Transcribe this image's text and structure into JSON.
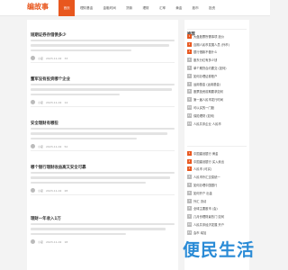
{
  "site": {
    "logo": "编故事"
  },
  "nav": [
    "首页",
    "理财基金",
    "金融时间",
    "贷款",
    "理财",
    "汇率",
    "黄金",
    "股市",
    "投资"
  ],
  "articles": [
    {
      "title": "短期证券存借债多少",
      "author": "小霍",
      "date": "2023-11-02",
      "views": "33"
    },
    {
      "title": "董军没有投资哪个企业",
      "author": "小霍",
      "date": "2023-11-02",
      "views": "14"
    },
    {
      "title": "安全理财有哪些",
      "author": "小霍",
      "date": "2023-11-02",
      "views": "52"
    },
    {
      "title": "哪个银行理财收益高又安全可靠",
      "author": "小霍",
      "date": "2023-11-02",
      "views": "28"
    },
    {
      "title": "理财一年收入1万",
      "author": "小霍",
      "date": "2023-11-02",
      "views": "18"
    }
  ],
  "sidebar": {
    "title": "推荐",
    "items_top": [
      "大盘股票所需事项 涨价",
      "百期人民币发展人员 (外币)",
      "银行借款不做什么",
      "股东分红有多少钱",
      "单个期货合约要交 (如何)",
      "如何办理证券账户",
      "运用基金 (运用基金)",
      "股票投资前期要求如何",
      "第一届人民币发行时间",
      "可以买的一门股",
      "保险理财 (如何)",
      "人民共享企业 人民币"
    ],
    "items_bottom": [
      "中国建设银行  黄金",
      "中国建设银行 买入卖出",
      "人民币 (可买)",
      "人民币外汇交易统一",
      "如何办理中国银行",
      "如何开户 出金",
      "外汇 流动",
      "全球主要股市 (会)",
      "几月份理财最热门 如何",
      "人民共享经济发展 开户",
      "会市 增加"
    ]
  },
  "watermark": "便民生活"
}
